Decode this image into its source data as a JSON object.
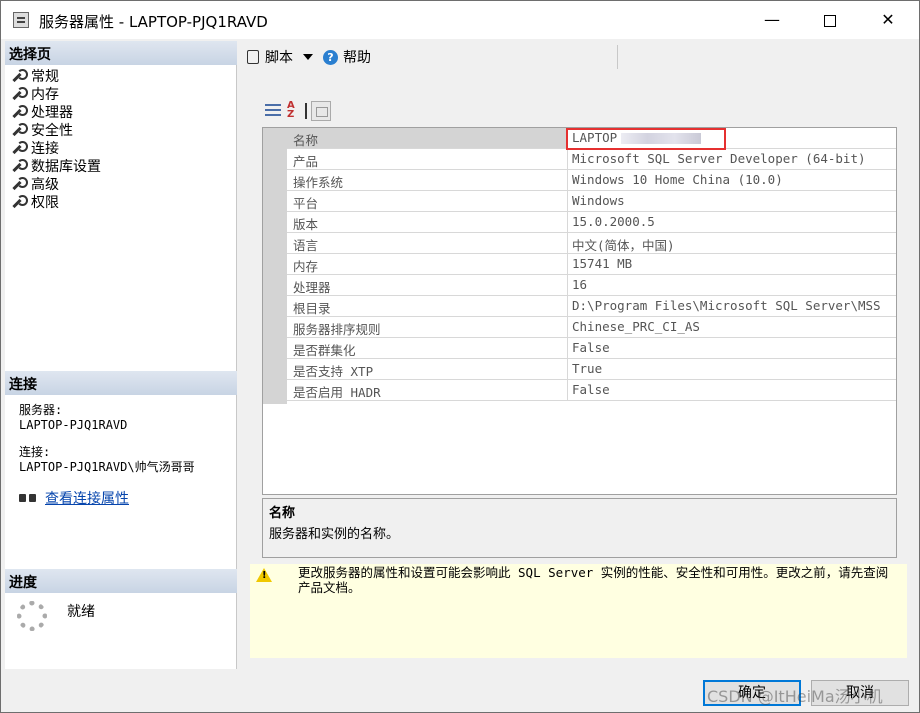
{
  "window": {
    "title": "服务器属性 - LAPTOP-PJQ1RAVD"
  },
  "left": {
    "pages_header": "选择页",
    "pages": [
      "常规",
      "内存",
      "处理器",
      "安全性",
      "连接",
      "数据库设置",
      "高级",
      "权限"
    ],
    "connection_header": "连接",
    "server_label": "服务器:",
    "server_value": "LAPTOP-PJQ1RAVD",
    "connection_label": "连接:",
    "connection_value": "LAPTOP-PJQ1RAVD\\帅气汤哥哥",
    "view_link": "查看连接属性",
    "progress_header": "进度",
    "status": "就绪"
  },
  "toolbar": {
    "script": "脚本",
    "help": "帮助"
  },
  "grid": {
    "rows": [
      {
        "name": "名称",
        "value": "LAPTOP"
      },
      {
        "name": "产品",
        "value": "Microsoft SQL Server Developer (64-bit)"
      },
      {
        "name": "操作系统",
        "value": "Windows 10 Home China (10.0)"
      },
      {
        "name": "平台",
        "value": "Windows"
      },
      {
        "name": "版本",
        "value": "15.0.2000.5"
      },
      {
        "name": "语言",
        "value": "中文(简体，中国)"
      },
      {
        "name": "内存",
        "value": "15741 MB"
      },
      {
        "name": "处理器",
        "value": "16"
      },
      {
        "name": "根目录",
        "value": "D:\\Program Files\\Microsoft SQL Server\\MSS"
      },
      {
        "name": "服务器排序规则",
        "value": "Chinese_PRC_CI_AS"
      },
      {
        "name": "是否群集化",
        "value": "False"
      },
      {
        "name": "是否支持 XTP",
        "value": "True"
      },
      {
        "name": "是否启用 HADR",
        "value": "False"
      }
    ]
  },
  "description": {
    "title": "名称",
    "text": "服务器和实例的名称。"
  },
  "warning": {
    "text": "更改服务器的属性和设置可能会影响此 SQL Server 实例的性能、安全性和可用性。更改之前，请先查阅产品文档。"
  },
  "buttons": {
    "ok": "确定",
    "cancel": "取消"
  },
  "watermark": "CSDN @ItHeiMa汤小机"
}
